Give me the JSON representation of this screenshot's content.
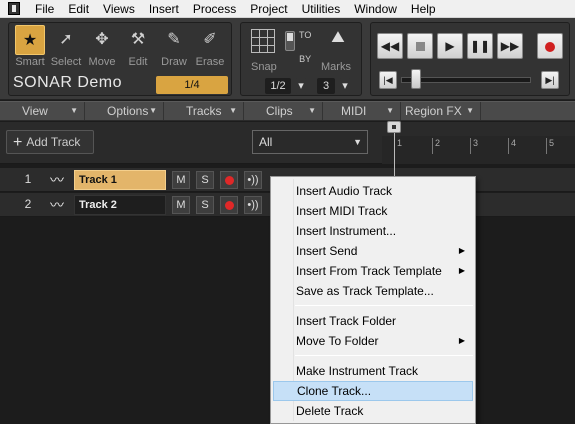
{
  "menubar": {
    "items": [
      "File",
      "Edit",
      "Views",
      "Insert",
      "Process",
      "Project",
      "Utilities",
      "Window",
      "Help"
    ]
  },
  "tools": {
    "items": [
      {
        "label": "Smart",
        "icon": "star-icon"
      },
      {
        "label": "Select",
        "icon": "cursor-icon"
      },
      {
        "label": "Move",
        "icon": "move-icon"
      },
      {
        "label": "Edit",
        "icon": "edit-icon"
      },
      {
        "label": "Draw",
        "icon": "pencil-icon"
      },
      {
        "label": "Erase",
        "icon": "eraser-icon"
      }
    ],
    "product": "SONAR Demo",
    "snap_value": "1/4"
  },
  "snap": {
    "snap_label": "Snap",
    "marks_label": "Marks",
    "to_by": "TO\nBY",
    "resolution": "1/2",
    "marks_count": "3"
  },
  "viewbar": {
    "items": [
      "View",
      "Options",
      "Tracks",
      "Clips",
      "MIDI",
      "Region FX"
    ]
  },
  "trackheader": {
    "add_track": "Add Track",
    "filter": "All",
    "ruler_ticks": [
      "1",
      "2",
      "3",
      "4",
      "5"
    ]
  },
  "tracks": [
    {
      "number": "1",
      "name": "Track 1",
      "mute": "M",
      "solo": "S",
      "selected": true
    },
    {
      "number": "2",
      "name": "Track 2",
      "mute": "M",
      "solo": "S",
      "selected": false
    }
  ],
  "context_menu": {
    "items": [
      {
        "label": "Insert Audio Track",
        "submenu": false
      },
      {
        "label": "Insert MIDI Track",
        "submenu": false
      },
      {
        "label": "Insert Instrument...",
        "submenu": false
      },
      {
        "label": "Insert Send",
        "submenu": true
      },
      {
        "label": "Insert From Track Template",
        "submenu": true
      },
      {
        "label": "Save as Track Template...",
        "submenu": false
      },
      {
        "label": "Insert Track Folder",
        "submenu": false
      },
      {
        "label": "Move To Folder",
        "submenu": true
      },
      {
        "label": "Make Instrument Track",
        "submenu": false
      },
      {
        "label": "Clone Track...",
        "submenu": false,
        "highlighted": true
      },
      {
        "label": "Delete Track",
        "submenu": false
      }
    ]
  },
  "colors": {
    "accent": "#d9a441",
    "record": "#e02828",
    "highlight": "#c6e0f7"
  }
}
